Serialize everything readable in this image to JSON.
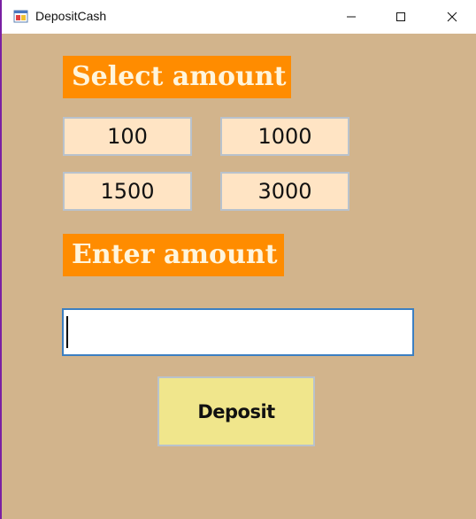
{
  "window": {
    "title": "DepositCash",
    "icon": "app-window-icon"
  },
  "titlebar_controls": {
    "minimize": "minimize-icon",
    "maximize": "maximize-icon",
    "close": "close-icon"
  },
  "select_section": {
    "heading": "Select amount",
    "amounts": [
      "100",
      "1000",
      "1500",
      "3000"
    ]
  },
  "enter_section": {
    "heading": "Enter amount",
    "input_value": ""
  },
  "deposit_button": {
    "label": "Deposit"
  },
  "colors": {
    "background": "#d2b48c",
    "heading_bg": "#ff8c00",
    "amount_button_bg": "#ffe4c4",
    "deposit_button_bg": "#f0e68c"
  }
}
